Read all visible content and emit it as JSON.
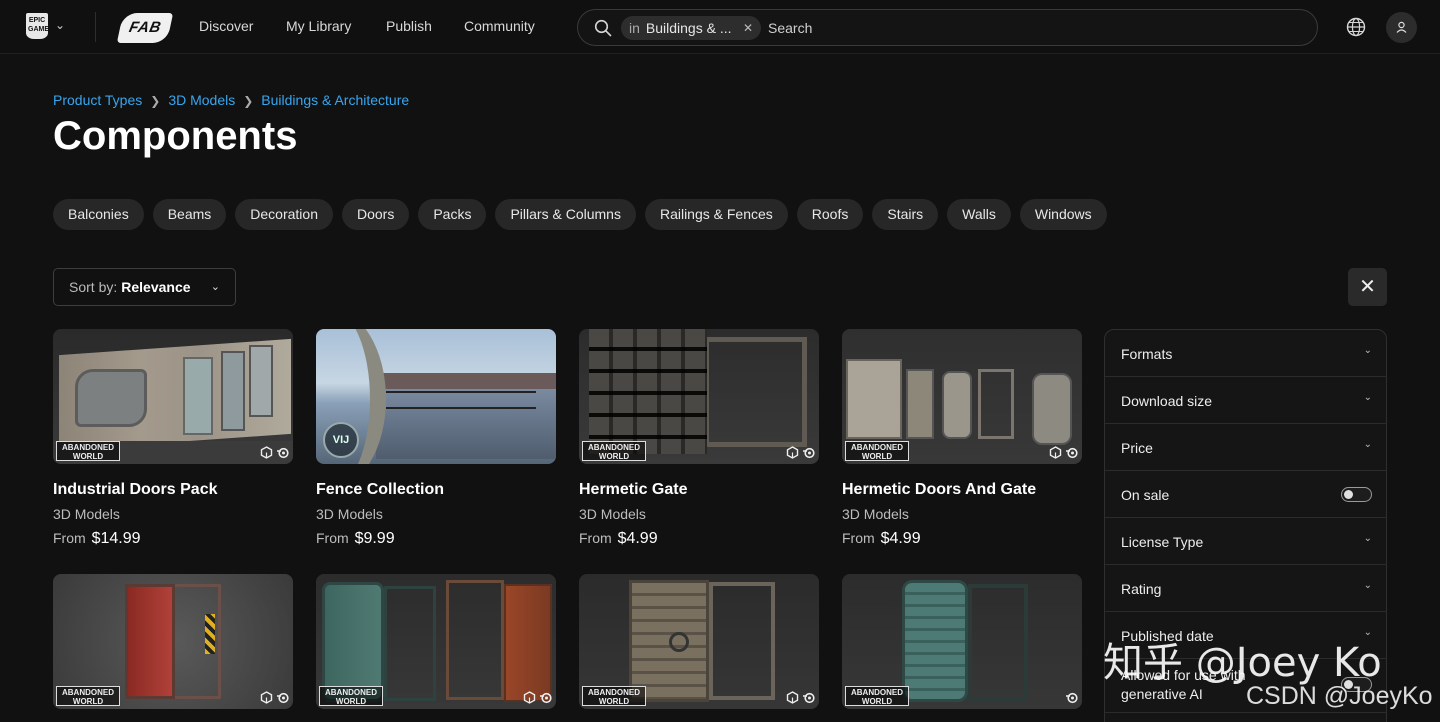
{
  "topbar": {
    "epic_logo_text": "EPIC GAMES",
    "fab_logo_text": "FAB",
    "nav": [
      "Discover",
      "My Library",
      "Publish",
      "Community"
    ],
    "search_scope_prefix": "in",
    "search_scope": "Buildings & ...",
    "search_placeholder": "Search",
    "icons": [
      "search-icon",
      "close-icon",
      "globe-icon",
      "user-icon"
    ]
  },
  "breadcrumb": [
    "Product Types",
    "3D Models",
    "Buildings & Architecture"
  ],
  "page_title": "Components",
  "categories": [
    "Balconies",
    "Beams",
    "Decoration",
    "Doors",
    "Packs",
    "Pillars & Columns",
    "Railings & Fences",
    "Roofs",
    "Stairs",
    "Walls",
    "Windows"
  ],
  "sort": {
    "label": "Sort by:",
    "value": "Relevance"
  },
  "products": [
    {
      "title": "Industrial Doors Pack",
      "type": "3D Models",
      "price_prefix": "From",
      "price": "$14.99",
      "badge": "ABANDONED WORLD",
      "engines": [
        "unity",
        "blender"
      ]
    },
    {
      "title": "Fence Collection",
      "type": "3D Models",
      "price_prefix": "From",
      "price": "$9.99",
      "badge": "VIJ",
      "engines": []
    },
    {
      "title": "Hermetic Gate",
      "type": "3D Models",
      "price_prefix": "From",
      "price": "$4.99",
      "badge": "ABANDONED WORLD",
      "engines": [
        "unity",
        "blender"
      ]
    },
    {
      "title": "Hermetic Doors And Gate",
      "type": "3D Models",
      "price_prefix": "From",
      "price": "$4.99",
      "badge": "ABANDONED WORLD",
      "engines": [
        "unity",
        "blender"
      ]
    },
    {
      "badge": "ABANDONED WORLD",
      "engines": [
        "unity",
        "blender"
      ]
    },
    {
      "badge": "ABANDONED WORLD",
      "engines": [
        "unity",
        "blender"
      ]
    },
    {
      "badge": "ABANDONED WORLD",
      "engines": [
        "unity",
        "blender"
      ]
    },
    {
      "badge": "ABANDONED WORLD",
      "engines": [
        "blender"
      ]
    }
  ],
  "filters": [
    {
      "label": "Formats",
      "control": "dropdown"
    },
    {
      "label": "Download size",
      "control": "dropdown"
    },
    {
      "label": "Price",
      "control": "dropdown"
    },
    {
      "label": "On sale",
      "control": "toggle",
      "on": false
    },
    {
      "label": "License Type",
      "control": "dropdown"
    },
    {
      "label": "Rating",
      "control": "dropdown"
    },
    {
      "label": "Published date",
      "control": "dropdown"
    },
    {
      "label": "Allowed for use with generative AI",
      "control": "toggle",
      "on": false
    }
  ],
  "watermark": {
    "line1": "知乎 @Joey Ko",
    "line2": "CSDN @JoeyKo"
  }
}
